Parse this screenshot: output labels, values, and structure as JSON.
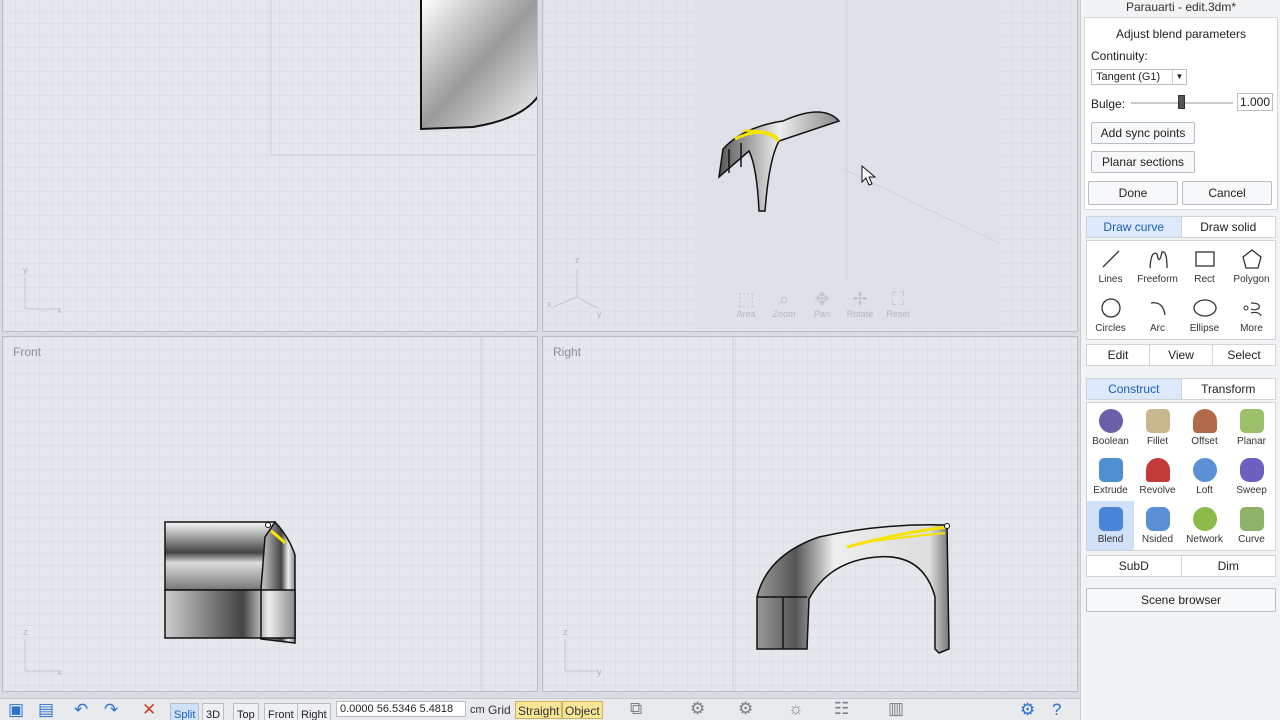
{
  "app": {
    "window_title": "Parauarti - edit.3dm*"
  },
  "viewports": {
    "top_left": {
      "label": "",
      "axis_y": "y",
      "axis_x": "x"
    },
    "perspective": {
      "label": "",
      "axis_z": "z",
      "axis_x": "x",
      "axis_y": "y",
      "nav": [
        {
          "label": "Area",
          "icon": "area-select-icon"
        },
        {
          "label": "Zoom",
          "icon": "zoom-icon"
        },
        {
          "label": "Pan",
          "icon": "pan-icon"
        },
        {
          "label": "Rotate",
          "icon": "rotate-icon"
        },
        {
          "label": "Reset",
          "icon": "reset-icon"
        }
      ]
    },
    "front": {
      "label": "Front",
      "axis_z": "z",
      "axis_x": "x"
    },
    "right": {
      "label": "Right",
      "axis_z": "z",
      "axis_y": "y"
    }
  },
  "blend": {
    "heading": "Adjust blend parameters",
    "continuity_label": "Continuity:",
    "continuity_value": "Tangent (G1)",
    "bulge_label": "Bulge:",
    "bulge_value": "1.000",
    "bulge_level": 0.5,
    "add_sync_points": "Add sync points",
    "planar_sections": "Planar sections",
    "done": "Done",
    "cancel": "Cancel"
  },
  "draw": {
    "tabs": [
      "Draw curve",
      "Draw solid"
    ],
    "tools": [
      {
        "label": "Lines",
        "icon": "line-icon"
      },
      {
        "label": "Freeform",
        "icon": "freeform-icon"
      },
      {
        "label": "Rect",
        "icon": "rect-icon"
      },
      {
        "label": "Polygon",
        "icon": "polygon-icon"
      },
      {
        "label": "Circles",
        "icon": "circle-icon"
      },
      {
        "label": "Arc",
        "icon": "arc-icon"
      },
      {
        "label": "Ellipse",
        "icon": "ellipse-icon"
      },
      {
        "label": "More",
        "icon": "more-icon"
      }
    ]
  },
  "edit_tabs": [
    "Edit",
    "View",
    "Select"
  ],
  "construct": {
    "tabs": [
      "Construct",
      "Transform"
    ],
    "tools": [
      {
        "label": "Boolean",
        "icon": "boolean-icon",
        "color": "#6b5fa8"
      },
      {
        "label": "Fillet",
        "icon": "fillet-icon",
        "color": "#c9b78f"
      },
      {
        "label": "Offset",
        "icon": "offset-icon",
        "color": "#b36a4a"
      },
      {
        "label": "Planar",
        "icon": "planar-icon",
        "color": "#9cbf6a"
      },
      {
        "label": "Extrude",
        "icon": "extrude-icon",
        "color": "#4f8fd0"
      },
      {
        "label": "Revolve",
        "icon": "revolve-icon",
        "color": "#c23b3b"
      },
      {
        "label": "Loft",
        "icon": "loft-icon",
        "color": "#5b8fd6"
      },
      {
        "label": "Sweep",
        "icon": "sweep-icon",
        "color": "#6b5fc0"
      },
      {
        "label": "Blend",
        "icon": "blend-icon",
        "color": "#4a86d8"
      },
      {
        "label": "Nsided",
        "icon": "nsided-icon",
        "color": "#5a8fd6"
      },
      {
        "label": "Network",
        "icon": "network-icon",
        "color": "#8dbb4a"
      },
      {
        "label": "Curve",
        "icon": "curve-icon",
        "color": "#8fb26a"
      }
    ]
  },
  "bottom_tabs": [
    "SubD",
    "Dim"
  ],
  "scene_browser": "Scene browser",
  "statusbar": {
    "view_tabs": [
      "Split",
      "3D",
      "Top",
      "Front",
      "Right"
    ],
    "coords": "0.0000   56.5346   5.4818",
    "unit": "cm",
    "grid": "Grid",
    "straight": "Straight",
    "object": "Object"
  }
}
